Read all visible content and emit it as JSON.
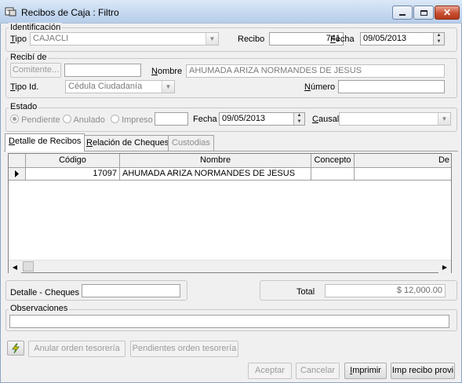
{
  "window": {
    "title": "Recibos de Caja : Filtro"
  },
  "identificacion": {
    "group_label": "Identificación",
    "tipo_label_u": "T",
    "tipo_label_rest": "ipo",
    "tipo_value": "CAJACLI",
    "recibo_label": "Recibo",
    "recibo_value": "741",
    "fecha_label_u": "F",
    "fecha_label_rest": "echa",
    "fecha_value": "09/05/2013"
  },
  "recibi_de": {
    "group_label": "Recibí de",
    "comitente_button": "Comitente...",
    "comitente_value": "",
    "nombre_label_u": "N",
    "nombre_label_rest": "ombre",
    "nombre_value": "AHUMADA ARIZA NORMANDES DE JESUS",
    "tipo_id_label_u": "T",
    "tipo_id_label_rest": "ipo Id.",
    "tipo_id_value": "Cédula Ciudadanía",
    "numero_label_u": "N",
    "numero_label_rest": "úmero",
    "numero_value": ""
  },
  "estado": {
    "group_label": "Estado",
    "pendiente_label": "Pendiente",
    "anulado_label": "Anulado",
    "impreso_label": "Impreso",
    "impreso_value": "",
    "fecha_label": "Fecha",
    "fecha_value": "09/05/2013",
    "causal_label_u": "C",
    "causal_label_rest": "ausal",
    "causal_value": ""
  },
  "tabs": [
    {
      "u": "D",
      "rest": "etalle de Recibos"
    },
    {
      "u": "R",
      "rest": "elación de Cheques"
    },
    {
      "u": "",
      "rest": "Custodias"
    }
  ],
  "grid": {
    "columns": [
      "Código",
      "Nombre",
      "Concepto",
      "De"
    ],
    "rows": [
      {
        "codigo": "17097",
        "nombre": "AHUMADA ARIZA NORMANDES DE JESUS",
        "concepto": "",
        "de": ""
      }
    ]
  },
  "totals": {
    "detalle_cheques_label": "Detalle - Cheques",
    "detalle_cheques_value": "",
    "total_label": "Total",
    "total_value": "$ 12,000.00"
  },
  "observaciones": {
    "label": "Observaciones",
    "value": ""
  },
  "actions": {
    "anular_label": "Anular orden tesorería",
    "pendientes_label": "Pendientes orden tesorería",
    "aceptar_label": "Aceptar",
    "cancelar_label": "Cancelar",
    "imprimir_u": "I",
    "imprimir_rest": "mprimir",
    "imp_recibo_label": "Imp recibo provi"
  }
}
